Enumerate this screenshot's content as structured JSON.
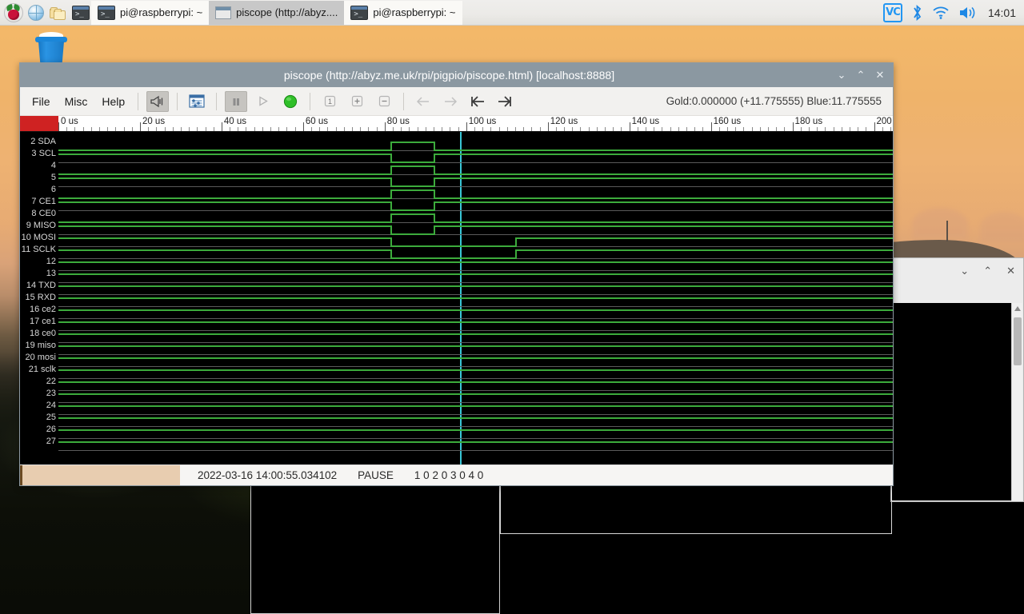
{
  "taskbar": {
    "launchers": [
      {
        "name": "raspberry-menu-icon",
        "label": "Raspberry Pi Menu"
      },
      {
        "name": "web-browser-icon",
        "label": "Web Browser"
      },
      {
        "name": "file-manager-icon",
        "label": "File Manager"
      },
      {
        "name": "terminal-icon",
        "label": "Terminal"
      }
    ],
    "tasks": [
      {
        "label": "pi@raspberrypi: ~",
        "icon": "terminal-icon",
        "state": "normal"
      },
      {
        "label": "piscope (http://abyz....",
        "icon": "window-icon",
        "state": "active"
      },
      {
        "label": "pi@raspberrypi: ~",
        "icon": "terminal-icon",
        "state": "normal"
      }
    ],
    "tray": {
      "vnc_label": "VC",
      "icons": [
        "vnc-icon",
        "bluetooth-icon",
        "wifi-icon",
        "volume-icon"
      ],
      "clock": "14:01"
    }
  },
  "desktop": {
    "trash_label": "Wastebasket"
  },
  "window": {
    "title": "piscope (http://abyz.me.uk/rpi/pigpio/piscope.html)   [localhost:8888]",
    "controls": {
      "minimize": "⌄",
      "maximize": "⌃",
      "close": "✕"
    },
    "menus": [
      "File",
      "Misc",
      "Help"
    ],
    "toolbar_icons": [
      "trigger-icon",
      "settings-icon",
      "pause-icon",
      "play-icon",
      "record-icon",
      "sample-1-icon",
      "zoom-in-icon",
      "zoom-out-icon",
      "step-back-icon",
      "step-forward-icon",
      "go-start-icon",
      "go-end-icon"
    ],
    "status_right": "Gold:0.000000 (+11.775555)  Blue:11.775555"
  },
  "ruler": {
    "labels": [
      "0 us",
      "20 us",
      "40 us",
      "60 us",
      "80 us",
      "100 us",
      "120 us",
      "140 us",
      "160 us",
      "180 us",
      "200 us"
    ],
    "unit": "us",
    "start": 0,
    "end": 200,
    "major_step": 20,
    "minor_step": 2
  },
  "gpio_channels": [
    {
      "num": "2",
      "name": "SDA"
    },
    {
      "num": "3",
      "name": "SCL"
    },
    {
      "num": "4",
      "name": ""
    },
    {
      "num": "5",
      "name": ""
    },
    {
      "num": "6",
      "name": ""
    },
    {
      "num": "7",
      "name": "CE1"
    },
    {
      "num": "8",
      "name": "CE0"
    },
    {
      "num": "9",
      "name": "MISO"
    },
    {
      "num": "10",
      "name": "MOSI"
    },
    {
      "num": "11",
      "name": "SCLK"
    },
    {
      "num": "12",
      "name": ""
    },
    {
      "num": "13",
      "name": ""
    },
    {
      "num": "14",
      "name": "TXD"
    },
    {
      "num": "15",
      "name": "RXD"
    },
    {
      "num": "16",
      "name": "ce2"
    },
    {
      "num": "17",
      "name": "ce1"
    },
    {
      "num": "18",
      "name": "ce0"
    },
    {
      "num": "19",
      "name": "miso"
    },
    {
      "num": "20",
      "name": "mosi"
    },
    {
      "num": "21",
      "name": "sclk"
    },
    {
      "num": "22",
      "name": ""
    },
    {
      "num": "23",
      "name": ""
    },
    {
      "num": "24",
      "name": ""
    },
    {
      "num": "25",
      "name": ""
    },
    {
      "num": "26",
      "name": ""
    },
    {
      "num": "27",
      "name": ""
    }
  ],
  "waveforms": {
    "note": "level per channel: 1 = high, 0 = low; transitions in us",
    "channels": [
      {
        "gpio": "2",
        "initial": 0,
        "transitions": [
          {
            "t": 81.5,
            "level": 1
          },
          {
            "t": 92.0,
            "level": 0
          }
        ]
      },
      {
        "gpio": "3",
        "initial": 1,
        "transitions": [
          {
            "t": 81.5,
            "level": 0
          },
          {
            "t": 92.0,
            "level": 1
          }
        ]
      },
      {
        "gpio": "4",
        "initial": 0,
        "transitions": [
          {
            "t": 81.5,
            "level": 1
          },
          {
            "t": 92.0,
            "level": 0
          }
        ]
      },
      {
        "gpio": "5",
        "initial": 1,
        "transitions": [
          {
            "t": 81.5,
            "level": 0
          },
          {
            "t": 92.0,
            "level": 1
          }
        ]
      },
      {
        "gpio": "6",
        "initial": 0,
        "transitions": [
          {
            "t": 81.5,
            "level": 1
          },
          {
            "t": 92.0,
            "level": 0
          }
        ]
      },
      {
        "gpio": "7",
        "initial": 1,
        "transitions": [
          {
            "t": 81.5,
            "level": 0
          },
          {
            "t": 92.0,
            "level": 1
          }
        ]
      },
      {
        "gpio": "8",
        "initial": 0,
        "transitions": [
          {
            "t": 81.5,
            "level": 1
          },
          {
            "t": 92.0,
            "level": 0
          }
        ]
      },
      {
        "gpio": "9",
        "initial": 1,
        "transitions": [
          {
            "t": 81.5,
            "level": 0
          },
          {
            "t": 92.0,
            "level": 1
          }
        ]
      },
      {
        "gpio": "10",
        "initial": 1,
        "transitions": [
          {
            "t": 81.5,
            "level": 0
          },
          {
            "t": 112.0,
            "level": 1
          }
        ]
      },
      {
        "gpio": "11",
        "initial": 1,
        "transitions": [
          {
            "t": 81.5,
            "level": 0
          },
          {
            "t": 112.0,
            "level": 1
          }
        ]
      },
      {
        "gpio": "12",
        "initial": 1,
        "transitions": []
      },
      {
        "gpio": "13",
        "initial": 1,
        "transitions": []
      },
      {
        "gpio": "14",
        "initial": 1,
        "transitions": []
      },
      {
        "gpio": "15",
        "initial": 1,
        "transitions": []
      },
      {
        "gpio": "16",
        "initial": 1,
        "transitions": []
      },
      {
        "gpio": "17",
        "initial": 1,
        "transitions": []
      },
      {
        "gpio": "18",
        "initial": 1,
        "transitions": []
      },
      {
        "gpio": "19",
        "initial": 1,
        "transitions": []
      },
      {
        "gpio": "20",
        "initial": 1,
        "transitions": []
      },
      {
        "gpio": "21",
        "initial": 1,
        "transitions": []
      },
      {
        "gpio": "22",
        "initial": 1,
        "transitions": []
      },
      {
        "gpio": "23",
        "initial": 1,
        "transitions": []
      },
      {
        "gpio": "24",
        "initial": 1,
        "transitions": []
      },
      {
        "gpio": "25",
        "initial": 1,
        "transitions": []
      },
      {
        "gpio": "26",
        "initial": 1,
        "transitions": []
      },
      {
        "gpio": "27",
        "initial": 1,
        "transitions": []
      }
    ],
    "blue_cursor_us": 11.775555,
    "gold_cursor_us": 0.0
  },
  "statusbar": {
    "timestamp": "2022-03-16 14:00:55.034102",
    "state": "PAUSE",
    "counters": "1 0  2 0  3 0  4 0"
  }
}
